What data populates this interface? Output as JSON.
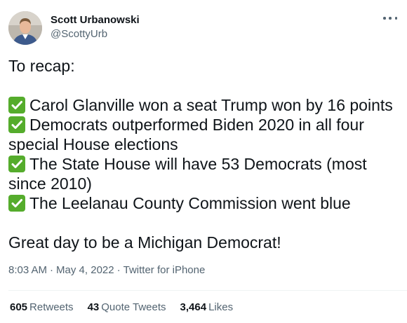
{
  "author": {
    "display_name": "Scott Urbanowski",
    "handle": "@ScottyUrb",
    "avatar_icon": "profile-photo"
  },
  "more_icon": "ellipsis-icon",
  "tweet": {
    "intro": "To recap:",
    "check_icon": "white-check-mark-emoji",
    "check_color": "#55ac2c",
    "items": [
      "Carol Glanville won a seat Trump won by 16 points",
      "Democrats outperformed Biden 2020 in all four special House elections",
      "The State House will have 53 Democrats (most since 2010)",
      "The Leelanau County Commission went blue"
    ],
    "closing": "Great day to be a Michigan Democrat!"
  },
  "meta": {
    "time": "8:03 AM",
    "date": "May 4, 2022",
    "source": "Twitter for iPhone",
    "separator": "·"
  },
  "stats": {
    "retweets_count": "605",
    "retweets_label": "Retweets",
    "quote_count": "43",
    "quote_label": "Quote Tweets",
    "likes_count": "3,464",
    "likes_label": "Likes"
  }
}
